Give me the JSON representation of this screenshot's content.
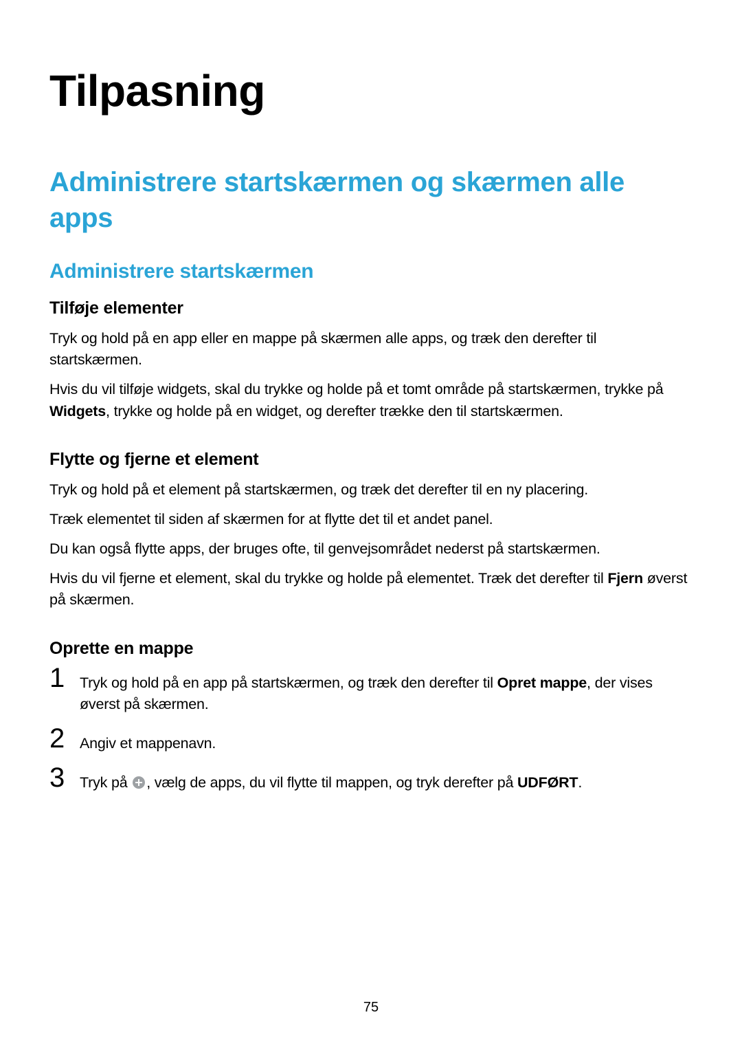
{
  "page_number": "75",
  "h1": "Tilpasning",
  "h2": "Administrere startskærmen og skærmen alle apps",
  "h3": "Administrere startskærmen",
  "sec1": {
    "title": "Tilføje elementer",
    "p1": "Tryk og hold på en app eller en mappe på skærmen alle apps, og træk den derefter til startskærmen.",
    "p2_a": "Hvis du vil tilføje widgets, skal du trykke og holde på et tomt område på startskærmen, trykke på ",
    "p2_bold": "Widgets",
    "p2_b": ", trykke og holde på en widget, og derefter trække den til startskærmen."
  },
  "sec2": {
    "title": "Flytte og fjerne et element",
    "p1": "Tryk og hold på et element på startskærmen, og træk det derefter til en ny placering.",
    "p2": "Træk elementet til siden af skærmen for at flytte det til et andet panel.",
    "p3": "Du kan også flytte apps, der bruges ofte, til genvejsområdet nederst på startskærmen.",
    "p4_a": "Hvis du vil fjerne et element, skal du trykke og holde på elementet. Træk det derefter til ",
    "p4_bold": "Fjern",
    "p4_b": " øverst på skærmen."
  },
  "sec3": {
    "title": "Oprette en mappe",
    "step1_num": "1",
    "step1_a": "Tryk og hold på en app på startskærmen, og træk den derefter til ",
    "step1_bold": "Opret mappe",
    "step1_b": ", der vises øverst på skærmen.",
    "step2_num": "2",
    "step2": "Angiv et mappenavn.",
    "step3_num": "3",
    "step3_a": "Tryk på ",
    "step3_b": ", vælg de apps, du vil flytte til mappen, og tryk derefter på ",
    "step3_bold": "UDFØRT",
    "step3_c": "."
  }
}
